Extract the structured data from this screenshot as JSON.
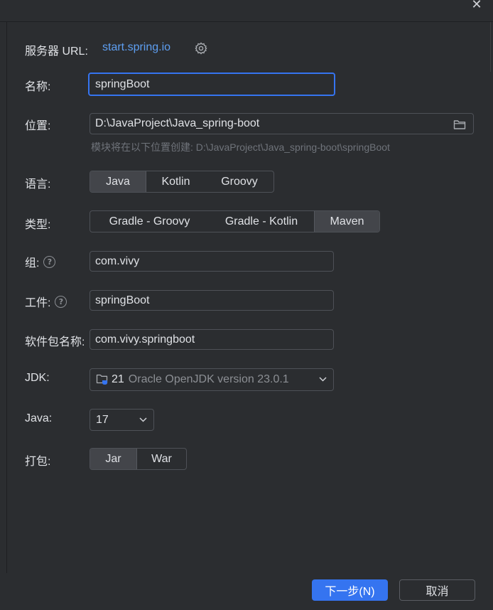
{
  "window": {
    "close_glyph": "✕"
  },
  "server": {
    "label": "服务器 URL:",
    "url": "start.spring.io",
    "icon": "gear-icon"
  },
  "name": {
    "label": "名称:",
    "value": "springBoot"
  },
  "location": {
    "label": "位置:",
    "value": "D:\\JavaProject\\Java_spring-boot",
    "hint": "模块将在以下位置创建: D:\\JavaProject\\Java_spring-boot\\springBoot",
    "icon": "folder-icon"
  },
  "language": {
    "label": "语言:",
    "options": [
      "Java",
      "Kotlin",
      "Groovy"
    ],
    "selected": "Java"
  },
  "type": {
    "label": "类型:",
    "options": [
      "Gradle - Groovy",
      "Gradle - Kotlin",
      "Maven"
    ],
    "selected": "Maven"
  },
  "group": {
    "label": "组:",
    "value": "com.vivy",
    "help_glyph": "?"
  },
  "artifact": {
    "label": "工件:",
    "value": "springBoot",
    "help_glyph": "?"
  },
  "package": {
    "label": "软件包名称:",
    "value": "com.vivy.springboot"
  },
  "jdk": {
    "label": "JDK:",
    "version": "21",
    "detail": "Oracle OpenJDK version 23.0.1"
  },
  "java": {
    "label": "Java:",
    "value": "17"
  },
  "packaging": {
    "label": "打包:",
    "options": [
      "Jar",
      "War"
    ],
    "selected": "Jar"
  },
  "footer": {
    "next": "下一步(N)",
    "cancel": "取消"
  },
  "colors": {
    "accent": "#3574f0",
    "link": "#5e9ff2",
    "background": "#2b2d30"
  }
}
